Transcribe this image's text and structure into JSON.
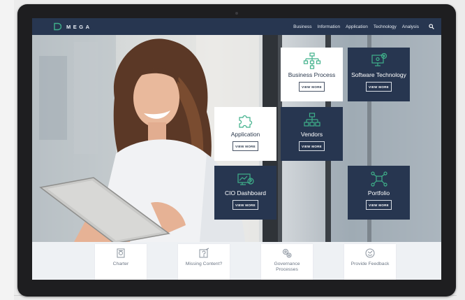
{
  "nav": {
    "logo_text": "MEGA",
    "menu": [
      "Business",
      "Information",
      "Application",
      "Technology",
      "Analysis"
    ]
  },
  "tiles": [
    {
      "label": "Business Process",
      "button": "VIEW MORE",
      "icon": "flowchart-icon",
      "style": "light"
    },
    {
      "label": "Software Technology",
      "button": "VIEW MORE",
      "icon": "monitor-gear-icon",
      "style": "dark"
    },
    {
      "label": "Application",
      "button": "VIEW MORE",
      "icon": "puzzle-icon",
      "style": "light"
    },
    {
      "label": "Vendors",
      "button": "VIEW MORE",
      "icon": "org-chart-icon",
      "style": "dark"
    },
    {
      "label": "CIO Dashboard",
      "button": "VIEW MORE",
      "icon": "dashboard-user-icon",
      "style": "dark"
    },
    {
      "label": "Portfolio",
      "button": "VIEW MORE",
      "icon": "network-icon",
      "style": "dark"
    }
  ],
  "cards": [
    {
      "label": "Charter",
      "icon": "charter-icon"
    },
    {
      "label": "Missing Content?",
      "icon": "missing-content-icon"
    },
    {
      "label": "Governance Processes",
      "icon": "governance-icon"
    },
    {
      "label": "Provide Feedback",
      "icon": "feedback-icon"
    }
  ],
  "colors": {
    "navy": "#273650",
    "accent_green": "#3fb08a",
    "light_tile": "#ffffff",
    "card_text": "#6d7785"
  }
}
